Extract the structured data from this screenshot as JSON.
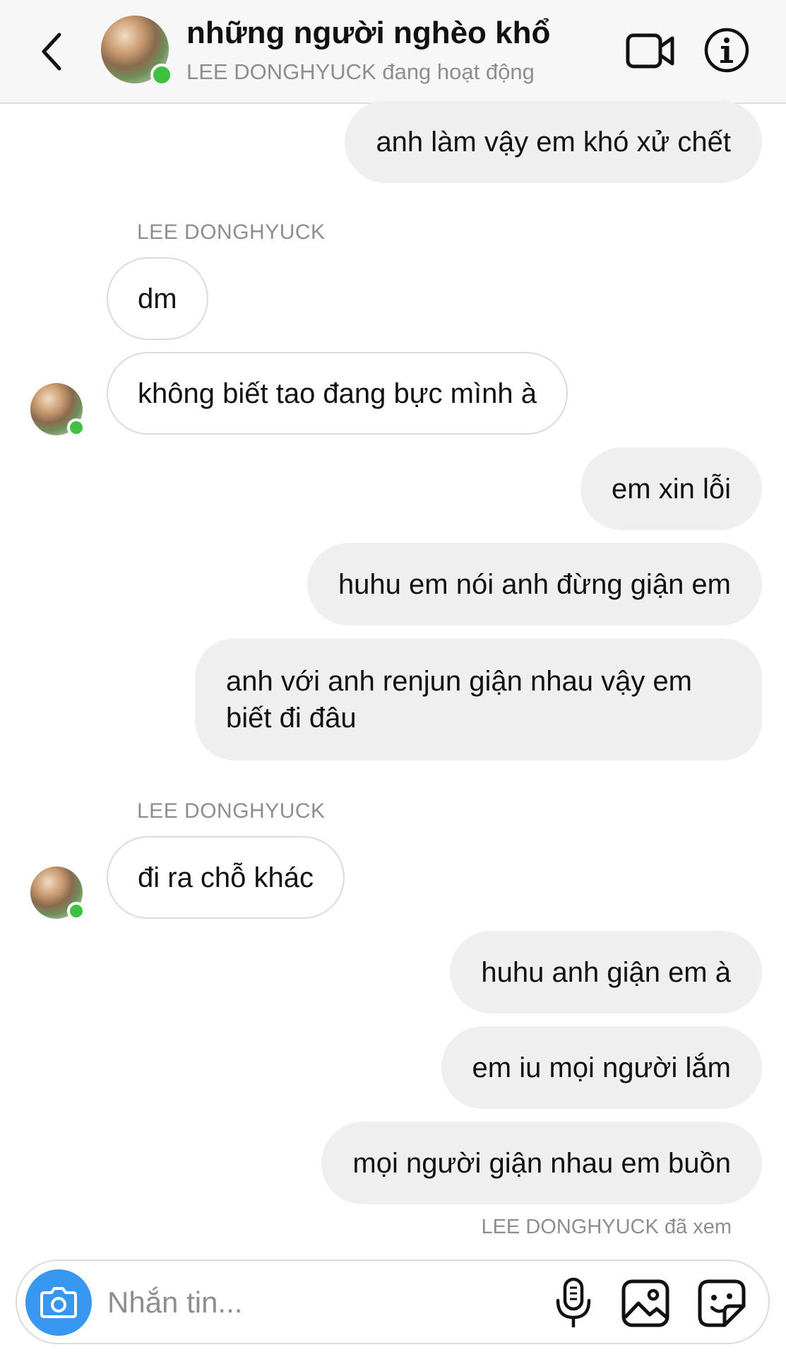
{
  "header": {
    "title": "những người nghèo khổ",
    "subtitle": "LEE DONGHYUCK đang hoạt động",
    "back_icon": "chevron-left-icon",
    "video_icon": "video-camera-icon",
    "info_icon": "info-icon"
  },
  "messages": [
    {
      "side": "out",
      "text": "anh làm vậy em khó xử chết"
    },
    {
      "side": "label",
      "text": "LEE DONGHYUCK"
    },
    {
      "side": "in",
      "text": "dm"
    },
    {
      "side": "in",
      "text": "không biết tao đang bực mình à"
    },
    {
      "side": "out",
      "text": "em xin lỗi"
    },
    {
      "side": "out",
      "text": "huhu em nói anh đừng giận em"
    },
    {
      "side": "out",
      "text": "anh với anh renjun giận nhau vậy em biết đi đâu"
    },
    {
      "side": "label",
      "text": "LEE DONGHYUCK"
    },
    {
      "side": "in",
      "text": "đi ra chỗ khác"
    },
    {
      "side": "out",
      "text": "huhu anh giận em à"
    },
    {
      "side": "out",
      "text": "em iu mọi người lắm"
    },
    {
      "side": "out",
      "text": "mọi người giận nhau em buồn"
    }
  ],
  "seen_status": "LEE DONGHYUCK đã xem",
  "composer": {
    "placeholder": "Nhắn tin...",
    "camera_icon": "camera-icon",
    "mic_icon": "microphone-icon",
    "gallery_icon": "image-gallery-icon",
    "sticker_icon": "sticker-icon"
  },
  "colors": {
    "online": "#3ec13e",
    "camera_button": "#3897f0",
    "outgoing_bubble": "#efefef",
    "secondary_text": "#8e8e8e"
  }
}
